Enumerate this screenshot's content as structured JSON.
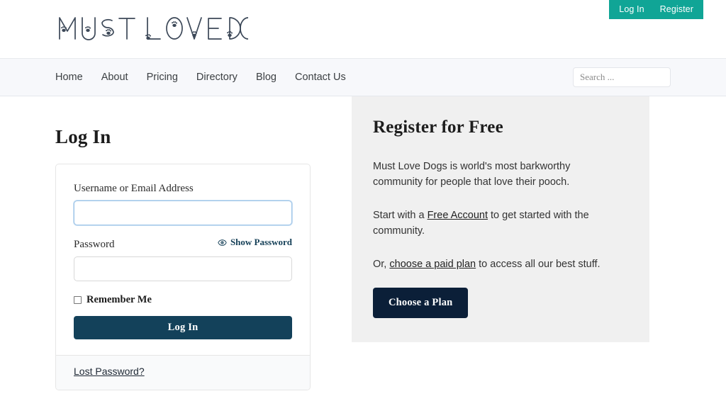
{
  "brand": {
    "logo_text": "MUST LOVE DOGS",
    "logo_icon": "paw-print-letters"
  },
  "header": {
    "auth": [
      {
        "label": "Log In",
        "name": "header-login-link"
      },
      {
        "label": "Register",
        "name": "header-register-link"
      }
    ],
    "accent_color": "#10a596"
  },
  "nav": {
    "items": [
      {
        "label": "Home"
      },
      {
        "label": "About"
      },
      {
        "label": "Pricing"
      },
      {
        "label": "Directory"
      },
      {
        "label": "Blog"
      },
      {
        "label": "Contact Us"
      }
    ],
    "search": {
      "placeholder": "Search ...",
      "value": ""
    }
  },
  "login": {
    "title": "Log In",
    "username_label": "Username or Email Address",
    "username_value": "",
    "password_label": "Password",
    "password_value": "",
    "show_password_label": "Show Password",
    "show_password_icon": "eye-icon",
    "remember_label": "Remember Me",
    "remember_checked": false,
    "submit_label": "Log In",
    "lost_password_label": "Lost Password?",
    "button_color": "#13415a"
  },
  "register": {
    "title": "Register for Free",
    "intro": "Must Love Dogs is world's most barkworthy community for people that love their pooch.",
    "line2_before": "Start with a ",
    "line2_link": "Free Account",
    "line2_after": " to get started with the community.",
    "line3_before": "Or, ",
    "line3_link": "choose a paid plan",
    "line3_after": " to access all our best stuff.",
    "cta_label": "Choose a Plan",
    "cta_color": "#0b1f38",
    "panel_color": "#f0f0f0"
  }
}
